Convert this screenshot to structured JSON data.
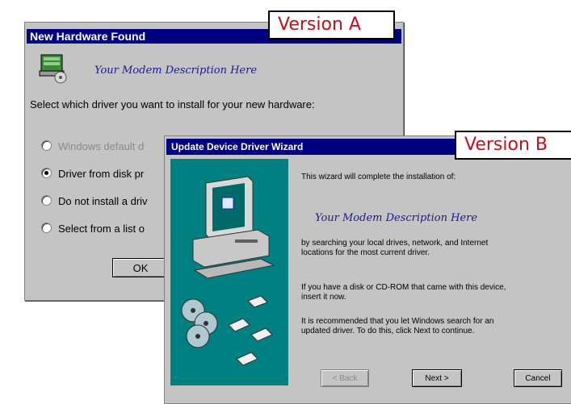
{
  "version_a": {
    "label": "Version A",
    "title": "New Hardware Found",
    "modem_description": "Your Modem Description Here",
    "prompt": "Select which driver you want to install for your new hardware:",
    "options": [
      {
        "label": "Windows default d",
        "checked": false,
        "disabled": true
      },
      {
        "label": "Driver from disk pr",
        "checked": true,
        "disabled": false
      },
      {
        "label": "Do not install a driv",
        "checked": false,
        "disabled": false
      },
      {
        "label": "Select from a list o",
        "checked": false,
        "disabled": false
      }
    ],
    "ok_button": "OK"
  },
  "version_b": {
    "label": "Version B",
    "title": "Update Device Driver Wizard",
    "intro": "This wizard will complete the installation of:",
    "modem_description": "Your Modem Description Here",
    "search_text_1": "by searching your local drives, network, and Internet",
    "search_text_2": "locations for the most current driver.",
    "disk_text_1": "If you have a disk or CD-ROM that came with this device,",
    "disk_text_2": "insert it now.",
    "recommend_text_1": "It is recommended that you let Windows search for an",
    "recommend_text_2": "updated driver. To do this, click Next to continue.",
    "back_button": "< Back",
    "next_button": "Next >",
    "cancel_button": "Cancel"
  },
  "colors": {
    "title_bar": "#000080",
    "dialog_bg": "#c4c4c4",
    "wizard_panel": "#008080",
    "version_label_text": "#c0101a",
    "modem_text": "#1a1a8a"
  }
}
